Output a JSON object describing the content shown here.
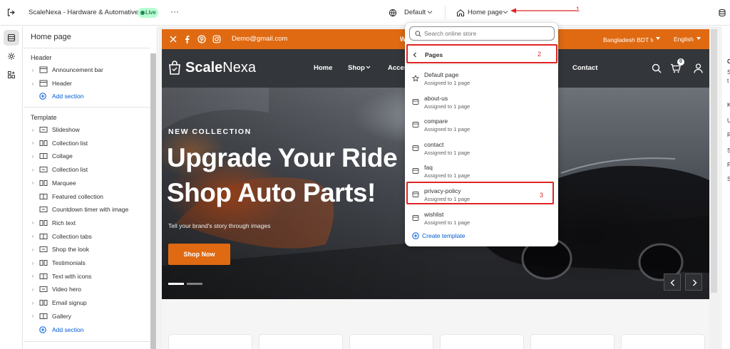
{
  "topbar": {
    "store_name": "ScaleNexa - Hardware & Automative",
    "live_badge": "Live",
    "more": "···",
    "theme_select": "Default",
    "page_select": "Home page"
  },
  "sidebar": {
    "title": "Home page",
    "header_group": "Header",
    "header_items": [
      {
        "label": "Announcement bar"
      },
      {
        "label": "Header"
      }
    ],
    "add_section": "Add section",
    "template_group": "Template",
    "template_items": [
      {
        "label": "Slideshow"
      },
      {
        "label": "Collection list"
      },
      {
        "label": "Collage"
      },
      {
        "label": "Collection list"
      },
      {
        "label": "Marquee"
      },
      {
        "label": "Featured collection"
      },
      {
        "label": "Countdown timer with image"
      },
      {
        "label": "Rich text"
      },
      {
        "label": "Collection tabs"
      },
      {
        "label": "Shop the look"
      },
      {
        "label": "Testimonials"
      },
      {
        "label": "Text with icons"
      },
      {
        "label": "Video hero"
      },
      {
        "label": "Email signup"
      },
      {
        "label": "Gallery"
      }
    ],
    "add_section_2": "Add section"
  },
  "site": {
    "announcement": {
      "email": "Demo@gmail.com",
      "center_text": "W",
      "currency": "Bangladesh BDT ৳",
      "language": "English"
    },
    "logo_bold": "Scale",
    "logo_light": "Nexa",
    "nav": [
      "Home",
      "Shop",
      "Access",
      "Contact"
    ],
    "cart_count": "0",
    "hero": {
      "eyebrow": "NEW COLLECTION",
      "headline_1": "Upgrade Your Ride",
      "headline_2": "Shop Auto Parts!",
      "subtext": "Tell your brand's story through images",
      "cta": "Shop Now"
    }
  },
  "dropdown": {
    "search_placeholder": "Search online store",
    "back_label": "Pages",
    "items": [
      {
        "name": "Default page",
        "sub": "Assigned to 1 page"
      },
      {
        "name": "about-us",
        "sub": "Assigned to 1 page"
      },
      {
        "name": "compare",
        "sub": "Assigned to 1 page"
      },
      {
        "name": "contact",
        "sub": "Assigned to 1 page"
      },
      {
        "name": "faq",
        "sub": "Assigned to 1 page"
      },
      {
        "name": "privacy-policy",
        "sub": "Assigned to 1 page"
      },
      {
        "name": "wishlist",
        "sub": "Assigned to 1 page"
      }
    ],
    "create": "Create template"
  },
  "annotations": {
    "n1": "1",
    "n2": "2",
    "n3": "3"
  },
  "rightstrip": {
    "letters": [
      "C",
      "S",
      "t",
      "K",
      "U",
      "R",
      "S",
      "P",
      "S"
    ]
  },
  "colors": {
    "announcement_bg": "#df6a12",
    "nav_bg": "#33363a",
    "cta_bg": "#df6a12",
    "accent_blue": "#005bd3",
    "annotation_red": "#e02424"
  }
}
